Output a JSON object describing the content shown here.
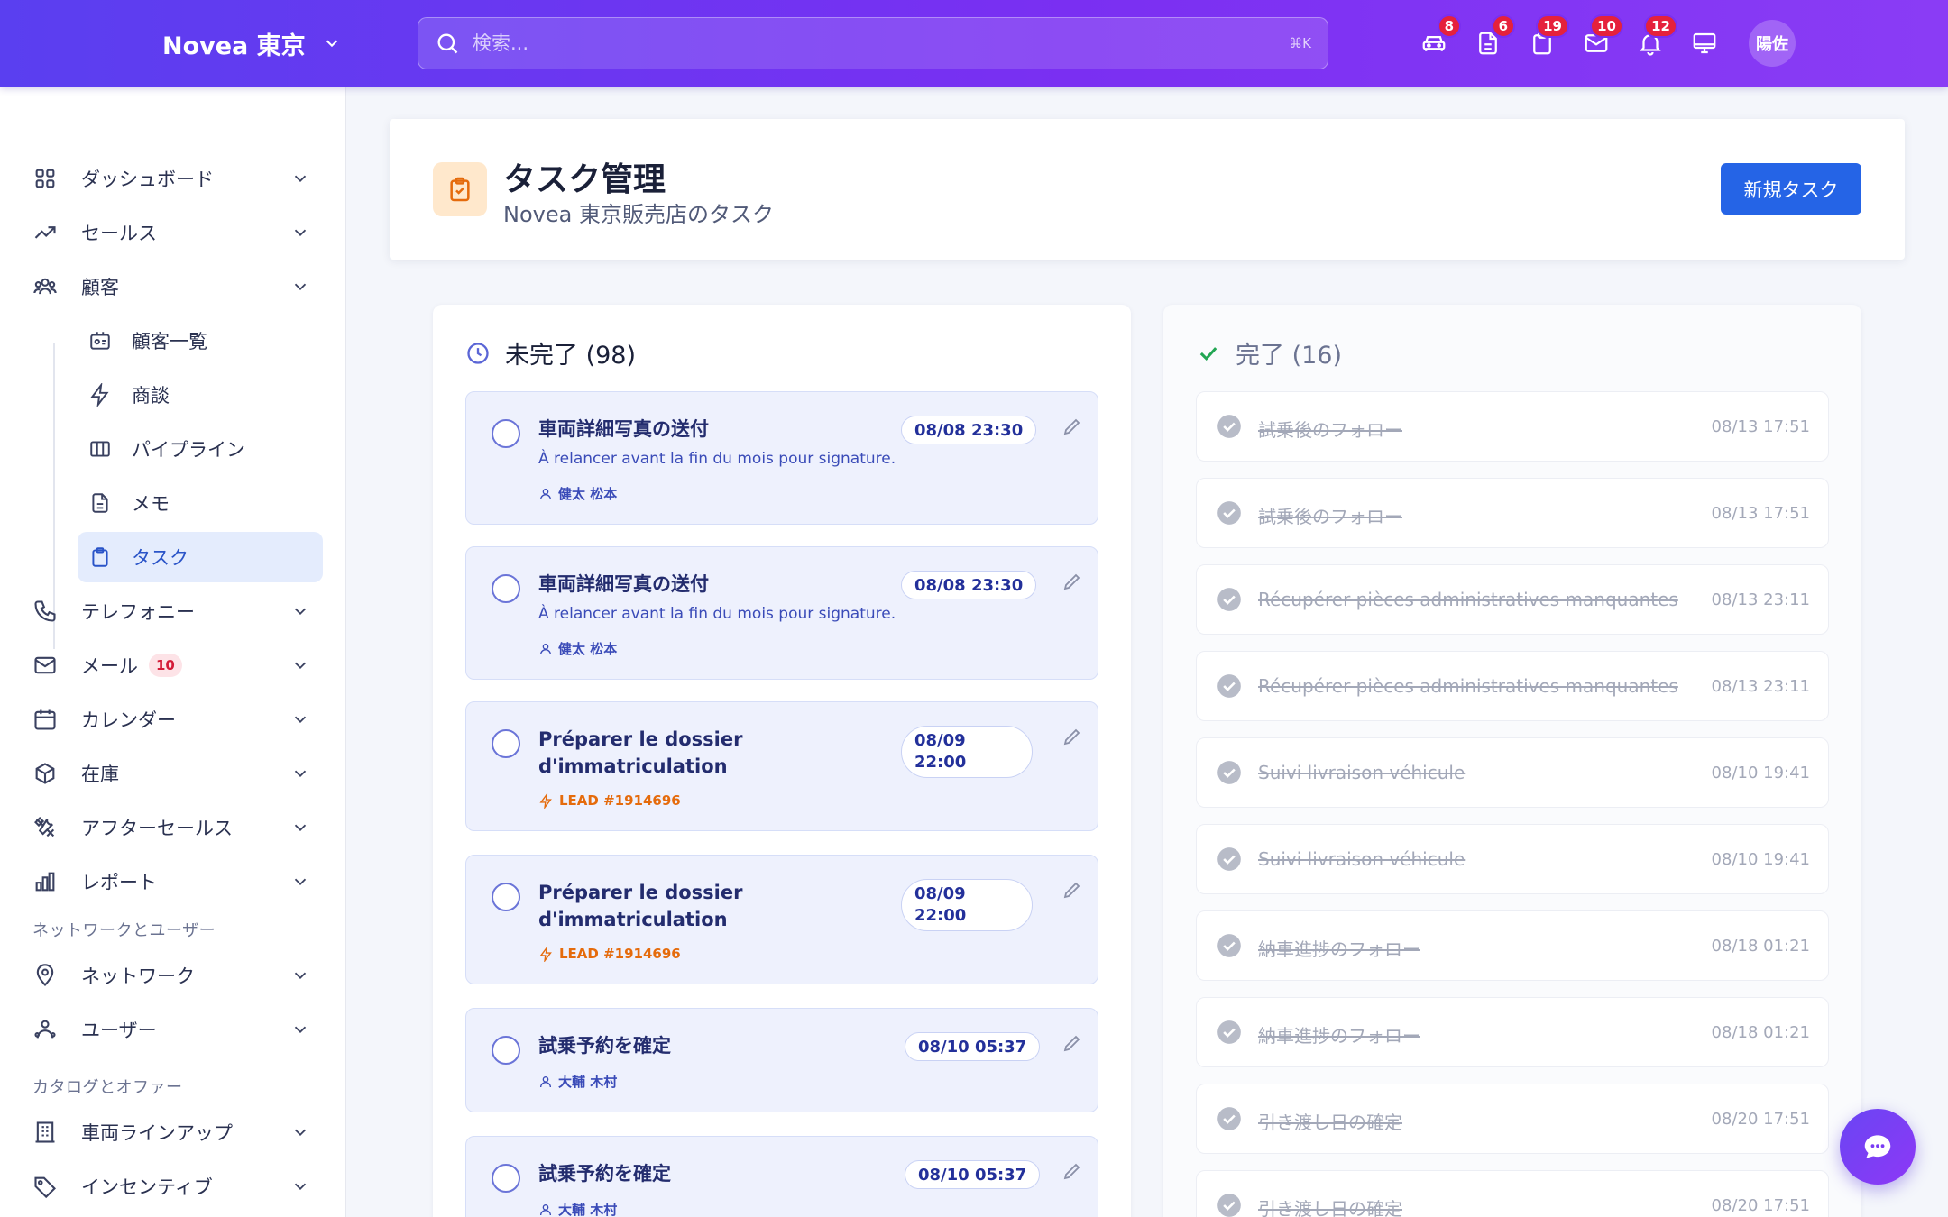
{
  "topbar": {
    "brand": "Novea 東京",
    "search_placeholder": "検索...",
    "search_shortcut": "⌘K",
    "icons": [
      {
        "name": "car-icon",
        "badge": "8"
      },
      {
        "name": "document-icon",
        "badge": "6"
      },
      {
        "name": "clipboard-icon",
        "badge": "19"
      },
      {
        "name": "mail-icon",
        "badge": "10"
      },
      {
        "name": "bell-icon",
        "badge": "12"
      },
      {
        "name": "monitor-icon",
        "badge": ""
      }
    ],
    "avatar": "陽佐"
  },
  "sidebar": {
    "items": [
      {
        "label": "ダッシュボード"
      },
      {
        "label": "セールス"
      },
      {
        "label": "顧客"
      },
      {
        "label": "テレフォニー"
      },
      {
        "label": "メール",
        "badge": "10"
      },
      {
        "label": "カレンダー"
      },
      {
        "label": "在庫"
      },
      {
        "label": "アフターセールス"
      },
      {
        "label": "レポート"
      },
      {
        "label": "ネットワーク"
      },
      {
        "label": "ユーザー"
      },
      {
        "label": "車両ラインアップ"
      },
      {
        "label": "インセンティブ"
      }
    ],
    "sub_items": [
      {
        "label": "顧客一覧"
      },
      {
        "label": "商談"
      },
      {
        "label": "パイプライン"
      },
      {
        "label": "メモ"
      },
      {
        "label": "タスク"
      }
    ],
    "sections": {
      "network": "ネットワークとユーザー",
      "catalog": "カタログとオファー"
    }
  },
  "header": {
    "title": "タスク管理",
    "subtitle": "Novea 東京販売店のタスク",
    "new_button": "新規タスク"
  },
  "open_column": {
    "heading": "未完了 (98)",
    "tasks": [
      {
        "title": "車両詳細写真の送付",
        "desc": "À relancer avant la fin du mois pour signature.",
        "user": "健太 松本",
        "date": "08/08 23:30"
      },
      {
        "title": "車両詳細写真の送付",
        "desc": "À relancer avant la fin du mois pour signature.",
        "user": "健太 松本",
        "date": "08/08 23:30"
      },
      {
        "title": "Préparer le dossier d'immatriculation",
        "lead": "LEAD #1914696",
        "date_line1": "08/09",
        "date_line2": "22:00"
      },
      {
        "title": "Préparer le dossier d'immatriculation",
        "lead": "LEAD #1914696",
        "date_line1": "08/09",
        "date_line2": "22:00"
      },
      {
        "title": "試乗予約を確定",
        "user": "大輔 木村",
        "date": "08/10 05:37"
      },
      {
        "title": "試乗予約を確定",
        "user": "大輔 木村",
        "date": "08/10 05:37"
      }
    ]
  },
  "done_column": {
    "heading": "完了 (16)",
    "tasks": [
      {
        "title": "試乗後のフォロー",
        "time": "08/13 17:51"
      },
      {
        "title": "試乗後のフォロー",
        "time": "08/13 17:51"
      },
      {
        "title": "Récupérer pièces administratives manquantes",
        "time": "08/13 23:11"
      },
      {
        "title": "Récupérer pièces administratives manquantes",
        "time": "08/13 23:11"
      },
      {
        "title": "Suivi livraison véhicule",
        "time": "08/10 19:41"
      },
      {
        "title": "Suivi livraison véhicule",
        "time": "08/10 19:41"
      },
      {
        "title": "納車進捗のフォロー",
        "time": "08/18 01:21"
      },
      {
        "title": "納車進捗のフォロー",
        "time": "08/18 01:21"
      },
      {
        "title": "引き渡し日の確定",
        "time": "08/20 17:51"
      },
      {
        "title": "引き渡し日の確定",
        "time": "08/20 17:51"
      }
    ]
  },
  "colors": {
    "accent": "#2564e6",
    "brand_start": "#5a3ff0",
    "brand_end": "#8a3cf5",
    "badge": "#e5213c",
    "lead": "#e56b0c"
  }
}
